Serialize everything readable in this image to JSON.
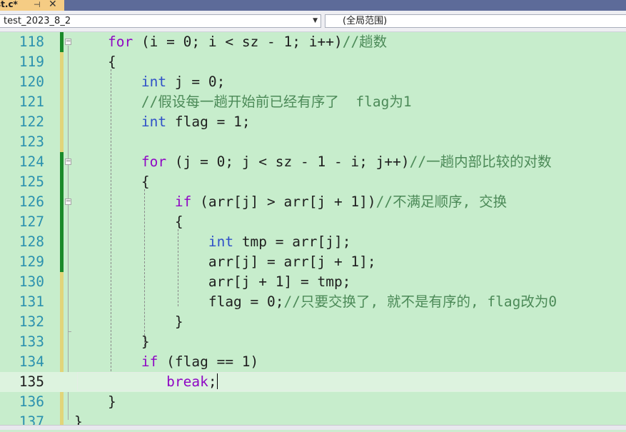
{
  "tab": {
    "title": "st.c*",
    "pin_icon": "pin-icon",
    "close_icon": "close-icon"
  },
  "nav": {
    "project": "test_2023_8_2",
    "scope": "(全局范围)"
  },
  "lines": [
    {
      "num": "118",
      "html": "<span class='tx'>    </span><span class='ctrl'>for</span><span class='tx'> (i = 0; i &lt; sz - 1; i++)</span><span class='cm'>//趟数</span>"
    },
    {
      "num": "119",
      "html": "<span class='tx'>    {</span>"
    },
    {
      "num": "120",
      "html": "<span class='tx'>        </span><span class='kw'>int</span><span class='tx'> j = 0;</span>"
    },
    {
      "num": "121",
      "html": "<span class='tx'>        </span><span class='cm'>//假设每一趟开始前已经有序了  flag为1</span>"
    },
    {
      "num": "122",
      "html": "<span class='tx'>        </span><span class='kw'>int</span><span class='tx'> flag = 1;</span>"
    },
    {
      "num": "123",
      "html": ""
    },
    {
      "num": "124",
      "html": "<span class='tx'>        </span><span class='ctrl'>for</span><span class='tx'> (j = 0; j &lt; sz - 1 - i; j++)</span><span class='cm'>//一趟内部比较的对数</span>"
    },
    {
      "num": "125",
      "html": "<span class='tx'>        {</span>"
    },
    {
      "num": "126",
      "html": "<span class='tx'>            </span><span class='ctrl'>if</span><span class='tx'> (arr[j] &gt; arr[j + 1])</span><span class='cm'>//不满足顺序, 交换</span>"
    },
    {
      "num": "127",
      "html": "<span class='tx'>            {</span>"
    },
    {
      "num": "128",
      "html": "<span class='tx'>                </span><span class='kw'>int</span><span class='tx'> tmp = arr[j];</span>"
    },
    {
      "num": "129",
      "html": "<span class='tx'>                arr[j] = arr[j + 1];</span>"
    },
    {
      "num": "130",
      "html": "<span class='tx'>                arr[j + 1] = tmp;</span>"
    },
    {
      "num": "131",
      "html": "<span class='tx'>                flag = 0;</span><span class='cm'>//只要交换了, 就不是有序的, flag改为0</span>"
    },
    {
      "num": "132",
      "html": "<span class='tx'>            }</span>"
    },
    {
      "num": "133",
      "html": "<span class='tx'>        }</span>"
    },
    {
      "num": "134",
      "html": "<span class='tx'>        </span><span class='ctrl'>if</span><span class='tx'> (flag == 1)</span>"
    },
    {
      "num": "135",
      "html": "<span class='tx'>           </span><span class='ctrl'>break</span><span class='tx'>;</span><span class='cursor'></span>"
    },
    {
      "num": "136",
      "html": "<span class='tx'>    }</span>"
    },
    {
      "num": "137",
      "html": "<span class='tx'>}</span>"
    }
  ],
  "current_line": "135",
  "colors": {
    "background": "#c7edcc",
    "keyword": "#2f50c8",
    "control": "#8f08c4",
    "comment": "#4c8a58",
    "line_number": "#2b91af"
  }
}
